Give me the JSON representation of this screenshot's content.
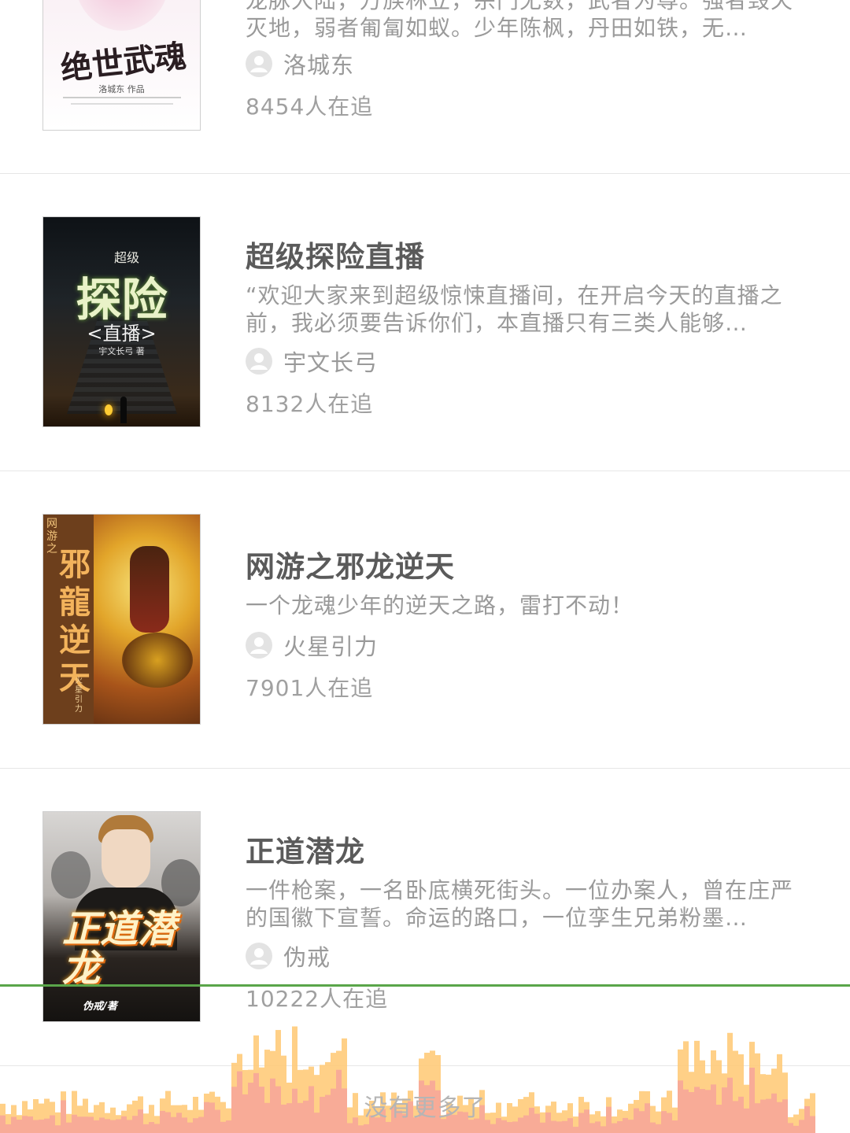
{
  "books": [
    {
      "title": "",
      "description": "龙脉大陆，万族林立，宗门无数，武者为尊。强者毁天灭地，弱者匍匐如蚁。少年陈枫，丹田如铁，无…",
      "author": "洛城东",
      "followers": "8454人在追",
      "cover": {
        "title_text": "绝世武魂",
        "byline": "洛城东 作品"
      }
    },
    {
      "title": "超级探险直播",
      "description": "“欢迎大家来到超级惊悚直播间，在开启今天的直播之前，我必须要告诉你们，本直播只有三类人能够…",
      "author": "宇文长弓",
      "followers": "8132人在追",
      "cover": {
        "top_text": "超级",
        "title_text": "探险",
        "sub_text": "<直播>",
        "byline": "宇文长弓 著"
      }
    },
    {
      "title": "网游之邪龙逆天",
      "description": "一个龙魂少年的逆天之路，雷打不动！",
      "author": "火星引力",
      "followers": "7901人在追",
      "cover": {
        "title_text": "邪龍逆天",
        "top_text": "网游之",
        "byline": "火星引力"
      }
    },
    {
      "title": "正道潜龙",
      "description": "一件枪案，一名卧底横死街头。一位办案人，曾在庄严的国徽下宣誓。命运的路口，一位孪生兄弟粉墨…",
      "author": "伪戒",
      "followers": "10222人在追",
      "cover": {
        "title_text": "正道潜龙",
        "byline": "伪戒/著"
      }
    }
  ],
  "footer": {
    "no_more": "没有更多了"
  },
  "colors": {
    "accent_line": "#5aa54a",
    "bars_a": "#ffc872",
    "bars_b": "#f7a59a"
  }
}
